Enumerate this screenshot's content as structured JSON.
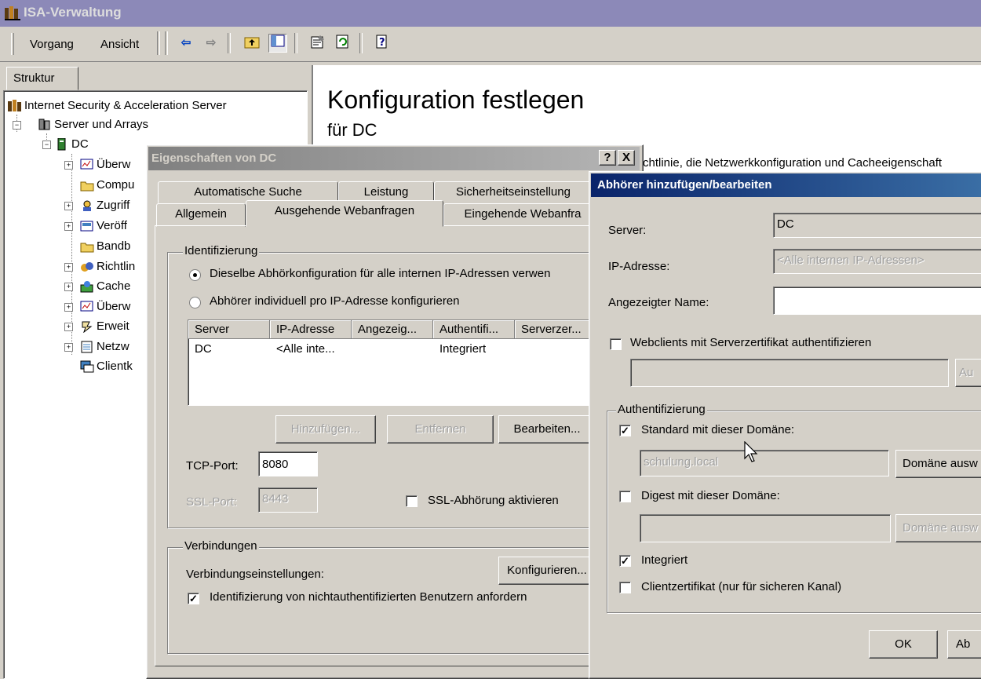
{
  "window": {
    "title": "ISA-Verwaltung"
  },
  "menubar": {
    "items": [
      {
        "label": "Vorgang"
      },
      {
        "label": "Ansicht"
      }
    ]
  },
  "toolbar": {
    "icons": [
      "back-arrow-icon",
      "forward-arrow-icon",
      "up-folder-icon",
      "show-hide-tree-icon",
      "properties-icon",
      "refresh-icon",
      "help-icon"
    ]
  },
  "left_pane": {
    "tab_label": "Struktur",
    "tree": [
      {
        "label": "Internet Security & Acceleration Server",
        "icon": "isa-server-icon"
      },
      {
        "label": "Server und Arrays",
        "icon": "server-array-icon"
      },
      {
        "label": "DC",
        "icon": "server-icon"
      },
      {
        "label": "Überw",
        "icon": "monitor-icon"
      },
      {
        "label": "Compu",
        "icon": "folder-icon"
      },
      {
        "label": "Zugriff",
        "icon": "access-icon"
      },
      {
        "label": "Veröff",
        "icon": "publish-icon"
      },
      {
        "label": "Bandb",
        "icon": "folder-icon"
      },
      {
        "label": "Richtlin",
        "icon": "policy-icon"
      },
      {
        "label": "Cache",
        "icon": "cache-icon"
      },
      {
        "label": "Überw",
        "icon": "monitor-icon"
      },
      {
        "label": "Erweit",
        "icon": "extension-icon"
      },
      {
        "label": "Netzw",
        "icon": "network-icon"
      },
      {
        "label": "Clientk",
        "icon": "client-icon"
      }
    ]
  },
  "right_pane": {
    "heading": "Konfiguration festlegen",
    "subheading": "für DC",
    "partial_text": "chtlinie, die Netzwerkkonfiguration und Cacheeigenschaft"
  },
  "dialog_dc": {
    "title": "Eigenschaften von DC",
    "help_btn": "?",
    "close_btn": "X",
    "tabs_row1": [
      "Automatische Suche",
      "Leistung",
      "Sicherheitseinstellung"
    ],
    "tabs_row2": [
      "Allgemein",
      "Ausgehende Webanfragen",
      "Eingehende Webanfra"
    ],
    "identification": {
      "group_label": "Identifizierung",
      "radio_same": "Dieselbe Abhörkonfiguration für alle internen IP-Adressen verwen",
      "radio_individual": "Abhörer individuell pro IP-Adresse konfigurieren",
      "columns": [
        "Server",
        "IP-Adresse",
        "Angezeig...",
        "Authentifi...",
        "Serverzer..."
      ],
      "rows": [
        [
          "DC",
          "<Alle inte...",
          "",
          "Integriert",
          ""
        ]
      ],
      "btn_add": "Hinzufügen...",
      "btn_remove": "Entfernen",
      "btn_edit": "Bearbeiten..."
    },
    "tcp_label": "TCP-Port:",
    "tcp_value": "8080",
    "ssl_label": "SSL-Port:",
    "ssl_value": "8443",
    "ssl_check": "SSL-Abhörung aktivieren",
    "connections": {
      "group_label": "Verbindungen",
      "settings_label": "Verbindungseinstellungen:",
      "btn_configure": "Konfigurieren...",
      "check_identify": "Identifizierung von nichtauthentifizierten Benutzern anfordern"
    }
  },
  "dialog_listener": {
    "title": "Abhörer hinzufügen/bearbeiten",
    "server_label": "Server:",
    "server_value": "DC",
    "ip_label": "IP-Adresse:",
    "ip_value": "<Alle internen IP-Adressen>",
    "display_label": "Angezeigter Name:",
    "display_value": "",
    "cert_check": "Webclients mit Serverzertifikat authentifizieren",
    "cert_btn": "Au",
    "auth": {
      "group_label": "Authentifizierung",
      "basic_check": "Standard mit dieser Domäne:",
      "basic_domain": "schulung.local",
      "basic_btn": "Domäne ausw",
      "digest_check": "Digest mit dieser Domäne:",
      "digest_domain": "",
      "digest_btn": "Domäne ausw",
      "integrated_check": "Integriert",
      "clientcert_check": "Clientzertifikat (nur für sicheren Kanal)"
    },
    "ok_btn": "OK",
    "cancel_btn": "Ab"
  },
  "colors": {
    "desktop_bg": "#d4d0c8",
    "active_title": "#0a246a",
    "inactive_title": "#808080",
    "outer_title": "#9a96be"
  }
}
